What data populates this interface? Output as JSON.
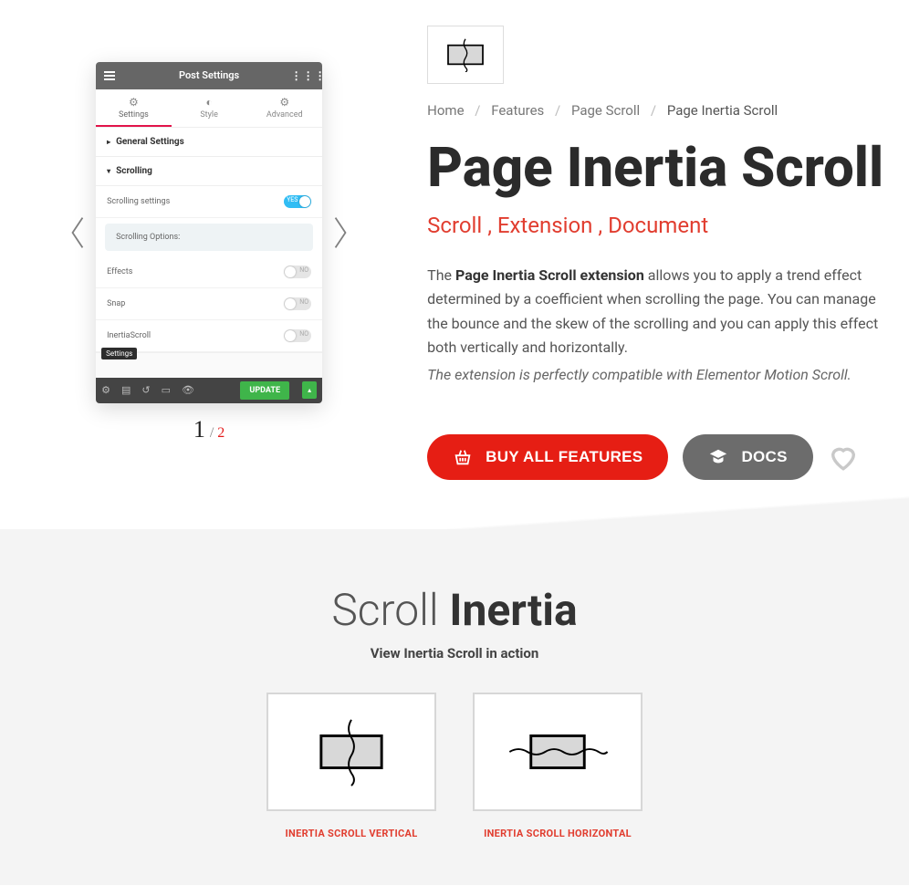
{
  "panel": {
    "topTitle": "Post Settings",
    "tabs": [
      "Settings",
      "Style",
      "Advanced"
    ],
    "sections": {
      "general": "General Settings",
      "scrolling": "Scrolling"
    },
    "rows": {
      "scrollingSettings": "Scrolling settings",
      "scrollingOptions": "Scrolling Options:",
      "effects": "Effects",
      "snap": "Snap",
      "inertia": "InertiaScroll"
    },
    "toggleYes": "YES",
    "toggleNo": "NO",
    "settingsChip": "Settings",
    "updateBtn": "UPDATE"
  },
  "carousel": {
    "current": "1",
    "total": "2"
  },
  "breadcrumb": {
    "home": "Home",
    "features": "Features",
    "pageScroll": "Page Scroll",
    "current": "Page Inertia Scroll"
  },
  "title": "Page Inertia Scroll",
  "tags": {
    "t1": "Scroll",
    "t2": "Extension",
    "t3": "Document"
  },
  "desc": {
    "pre": "The ",
    "bold": "Page Inertia Scroll extension",
    "post": " allows you to apply a trend effect determined by a coefficient when scrolling the page. You can manage the bounce and the skew of the scrolling and you can apply this effect both vertically and horizontally.",
    "italic": "The extension is perfectly compatible with Elementor Motion Scroll."
  },
  "actions": {
    "buy": "BUY ALL FEATURES",
    "docs": "DOCS"
  },
  "section": {
    "h2a": "Scroll ",
    "h2b": "Inertia",
    "sub": "View Inertia Scroll in action",
    "card1": "INERTIA SCROLL VERTICAL",
    "card2": "INERTIA SCROLL HORIZONTAL"
  }
}
